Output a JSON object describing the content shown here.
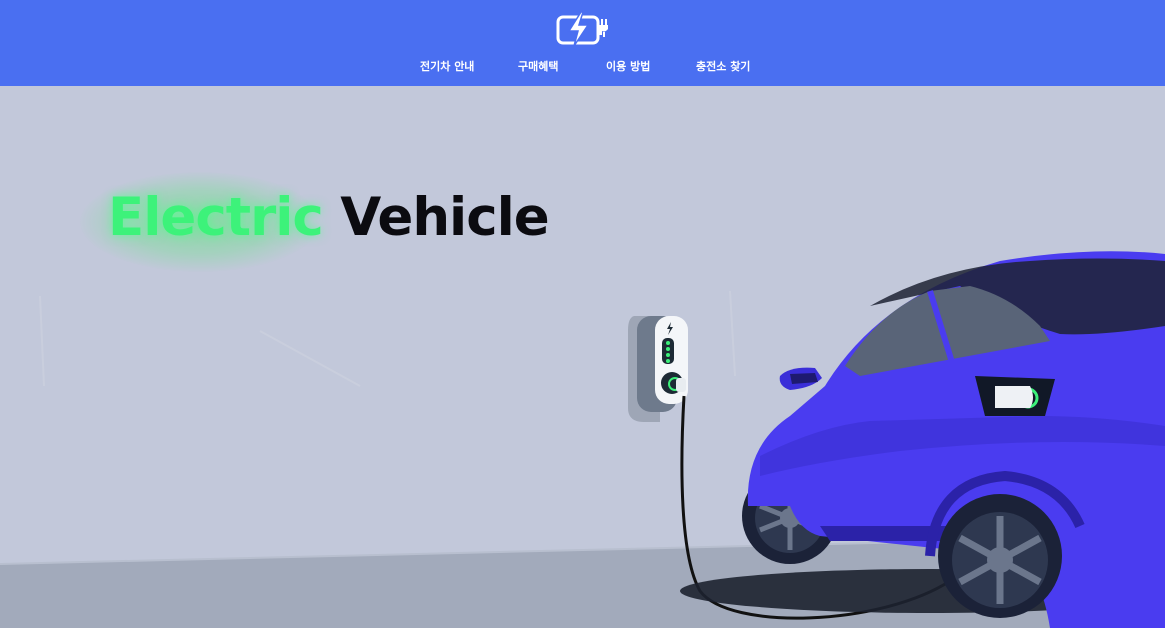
{
  "header": {
    "logo_icon": "battery-charging-plug-icon",
    "background_color": "#4a6ff1",
    "nav": [
      {
        "label": "전기차 안내"
      },
      {
        "label": "구매혜택"
      },
      {
        "label": "이용 방법"
      },
      {
        "label": "충전소 찾기"
      }
    ]
  },
  "hero": {
    "title_highlight": "Electric",
    "title_rest": "Vehicle",
    "highlight_color": "#3df27a",
    "illustration": "electric-car-charging-illustration"
  }
}
